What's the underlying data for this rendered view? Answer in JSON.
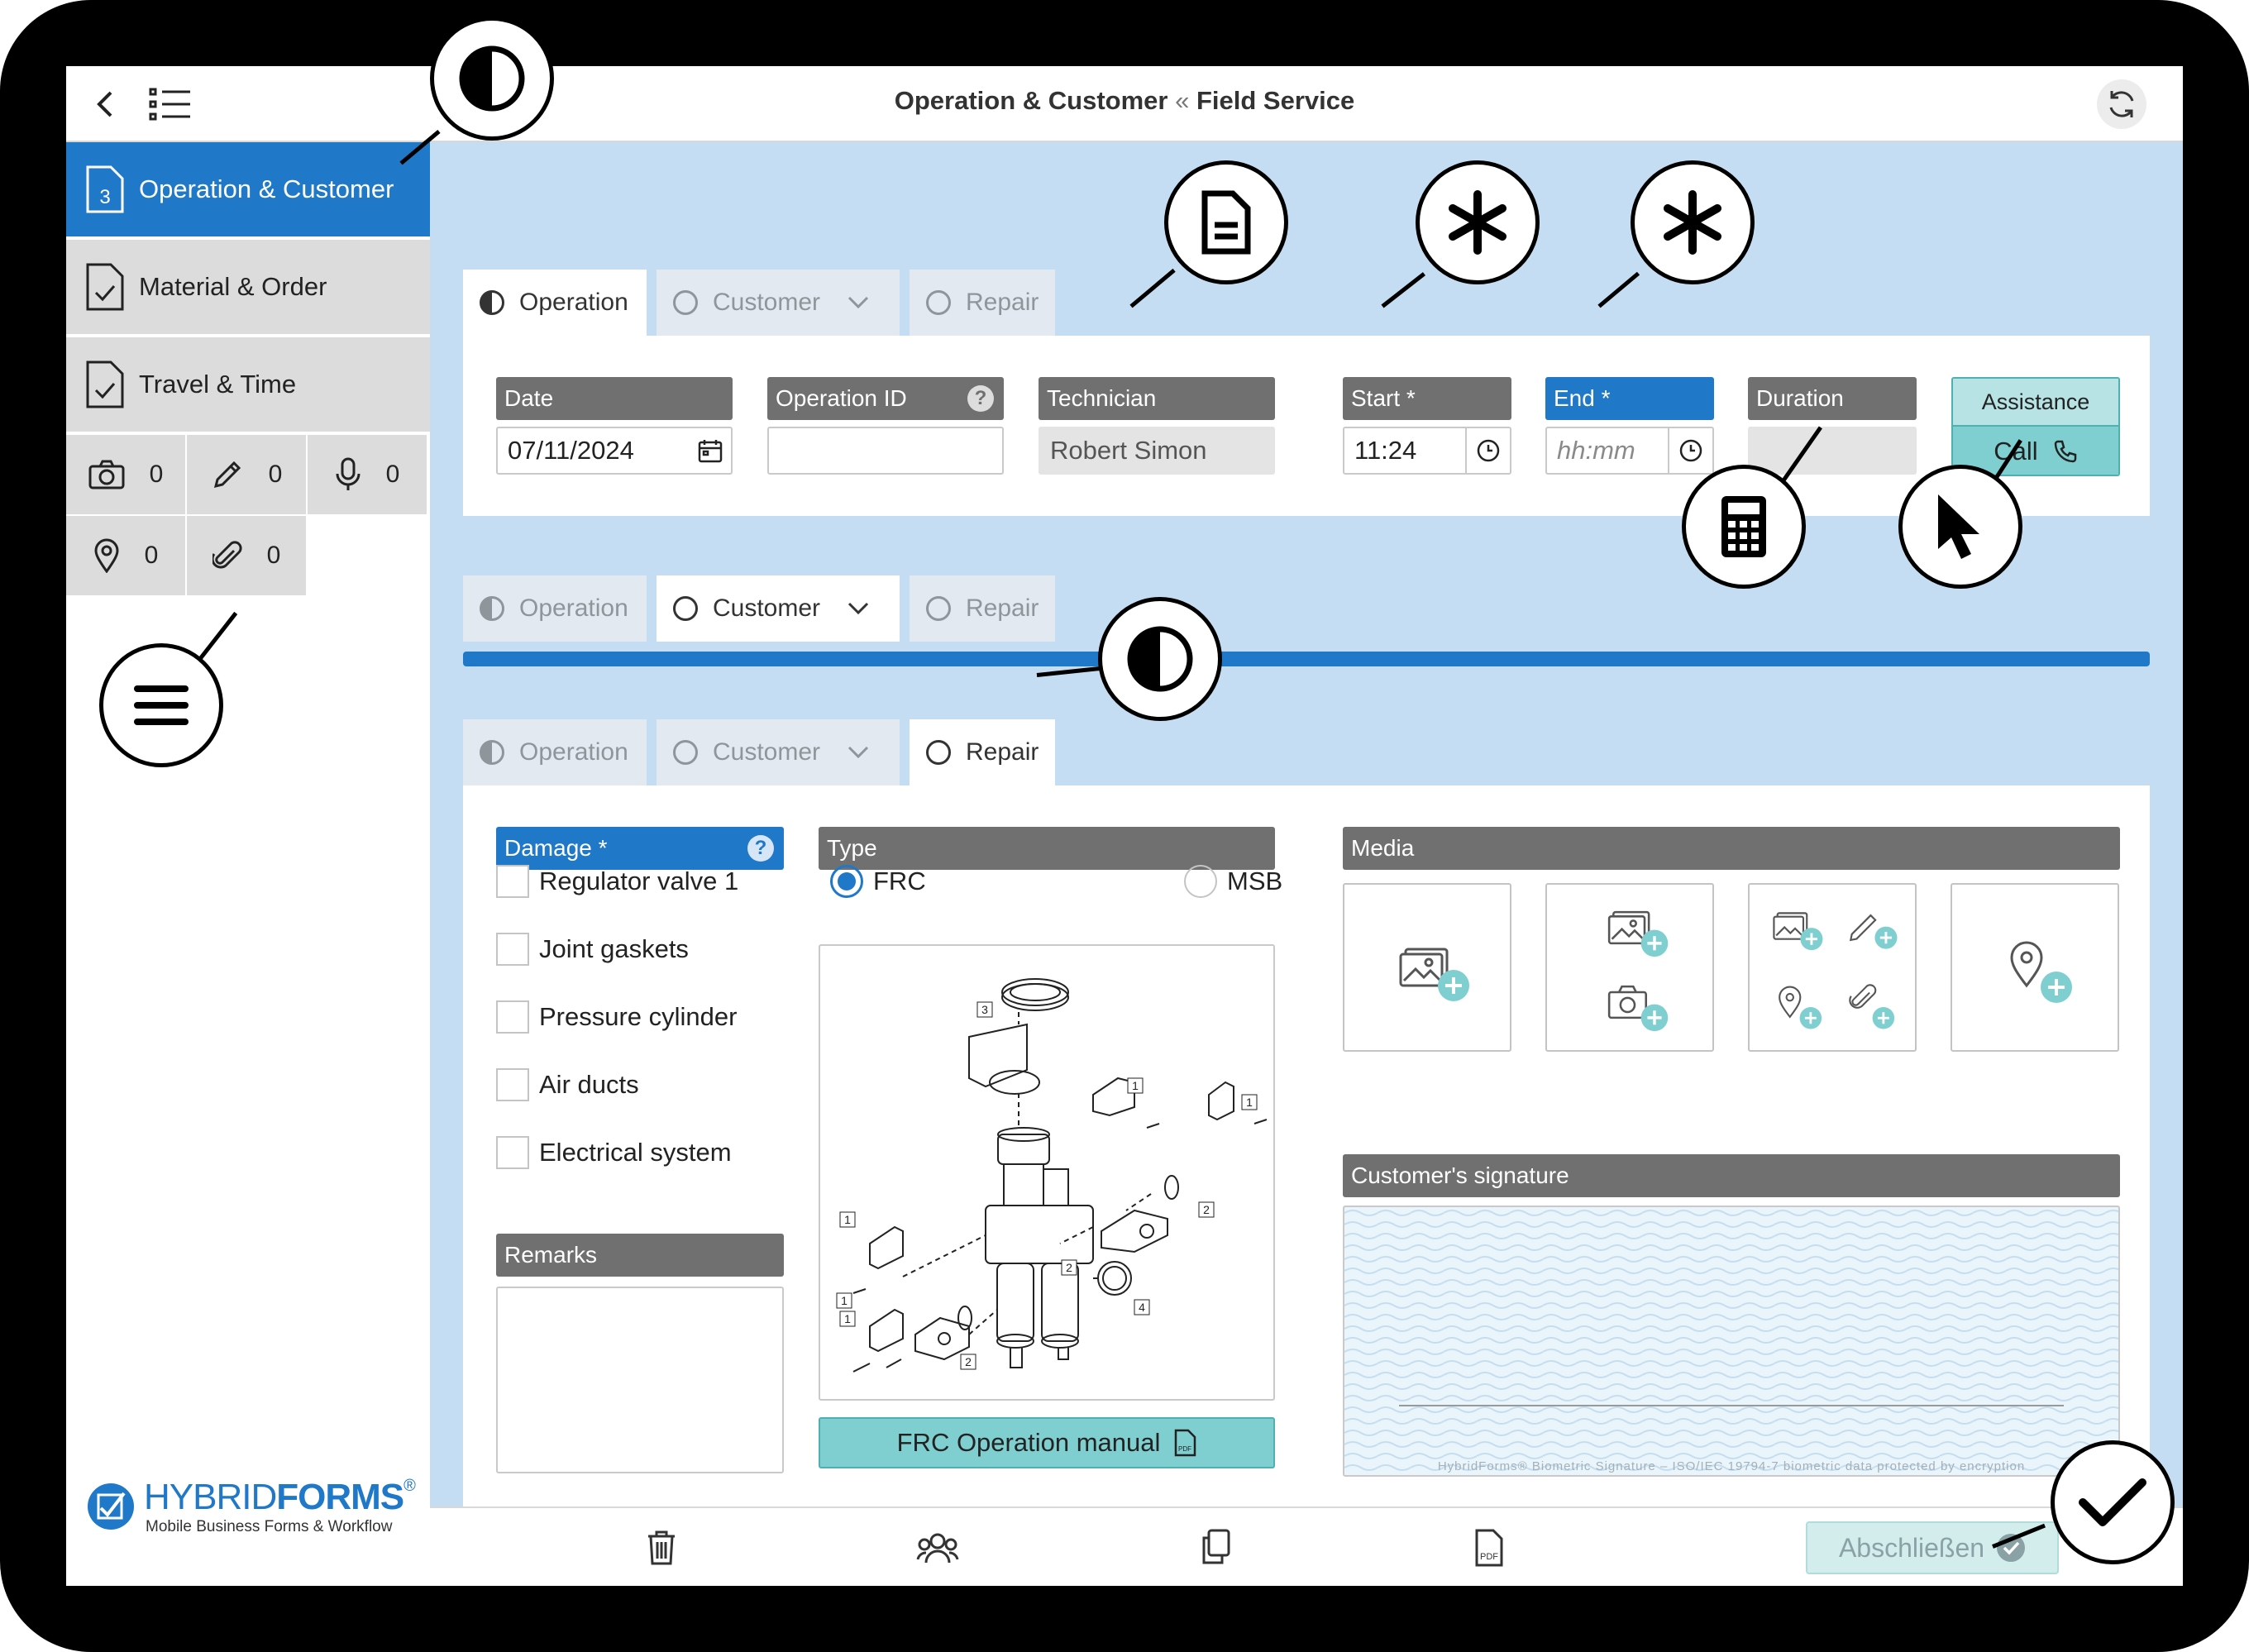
{
  "header": {
    "title_main": "Operation & Customer",
    "title_sep": "«",
    "title_sub": "Field Service"
  },
  "sidebar": {
    "items": [
      {
        "label": "Operation & Customer",
        "badge": "3"
      },
      {
        "label": "Material & Order"
      },
      {
        "label": "Travel & Time"
      }
    ],
    "counters": {
      "photos": "0",
      "sketches": "0",
      "audio": "0",
      "locations": "0",
      "attachments": "0"
    }
  },
  "tabs": {
    "operation": "Operation",
    "customer": "Customer",
    "repair": "Repair"
  },
  "operation": {
    "date_label": "Date",
    "date_value": "07/11/2024",
    "opid_label": "Operation ID",
    "opid_value": "",
    "tech_label": "Technician",
    "tech_value": "Robert Simon",
    "start_label": "Start *",
    "start_value": "11:24",
    "end_label": "End *",
    "end_placeholder": "hh:mm",
    "duration_label": "Duration",
    "assistance_label": "Assistance",
    "call_label": "Call"
  },
  "repair": {
    "damage_label": "Damage *",
    "damage_options": [
      "Regulator valve 1",
      "Joint gaskets",
      "Pressure cylinder",
      "Air ducts",
      "Electrical system"
    ],
    "remarks_label": "Remarks",
    "type_label": "Type",
    "type_options": [
      "FRC",
      "MSB"
    ],
    "type_selected": "FRC",
    "diagram_labels": [
      "3",
      "1",
      "1",
      "1",
      "2",
      "1",
      "1",
      "2",
      "4",
      "2"
    ],
    "manual_button": "FRC Operation manual",
    "media_label": "Media",
    "signature_label": "Customer's signature",
    "signature_footer": "HybridForms® Biometric Signature  –  ISO/IEC 19794-7 biometric data protected by encryption"
  },
  "footer": {
    "finish_button": "Abschließen"
  },
  "brand": {
    "name_light": "HYBRID",
    "name_bold": "FORMS",
    "reg": "®",
    "tagline": "Mobile Business Forms & Workflow"
  },
  "colors": {
    "accent": "#1f78c8",
    "teal": "#7fcfd0",
    "bg": "#c5ddf3",
    "header_grey": "#707070"
  }
}
